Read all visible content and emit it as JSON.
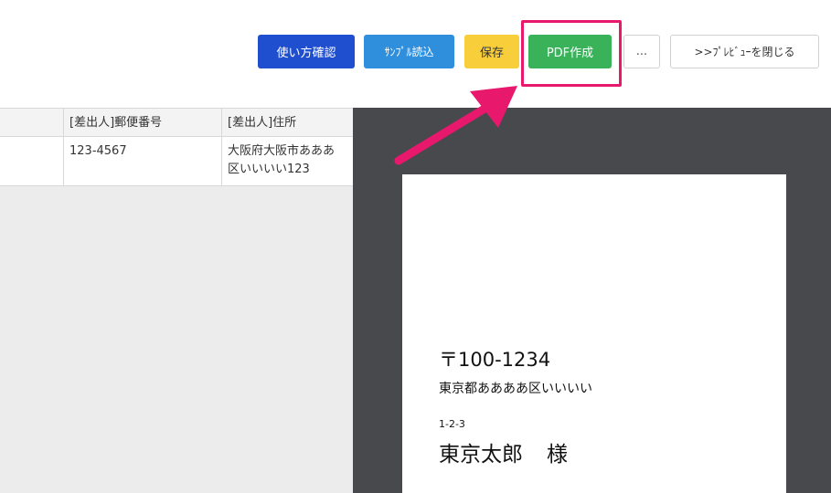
{
  "toolbar": {
    "howto_label": "使い方確認",
    "sample_label": "ｻﾝﾌﾟﾙ読込",
    "save_label": "保存",
    "pdf_label": "PDF作成",
    "more_label": "...",
    "close_preview_label": ">>ﾌﾟﾚﾋﾞｭｰを閉じる"
  },
  "table": {
    "headers": [
      "",
      "[差出人]郵便番号",
      "[差出人]住所"
    ],
    "rows": [
      {
        "cells": [
          "",
          "123-4567",
          "大阪府大阪市あああ",
          "区いいいい123"
        ]
      }
    ]
  },
  "preview": {
    "postal": "〒100-1234",
    "address_line1": "東京都ああああ区いいいい",
    "address_line2": "1-2-3",
    "name": "東京太郎",
    "honorific": "様"
  },
  "colors": {
    "highlight": "#e8186d",
    "pdf_button": "#39b25a",
    "howto_button": "#1f4fcf",
    "sample_button": "#2f8fdd",
    "save_button": "#f8cf3b",
    "preview_bg": "#48494d"
  }
}
